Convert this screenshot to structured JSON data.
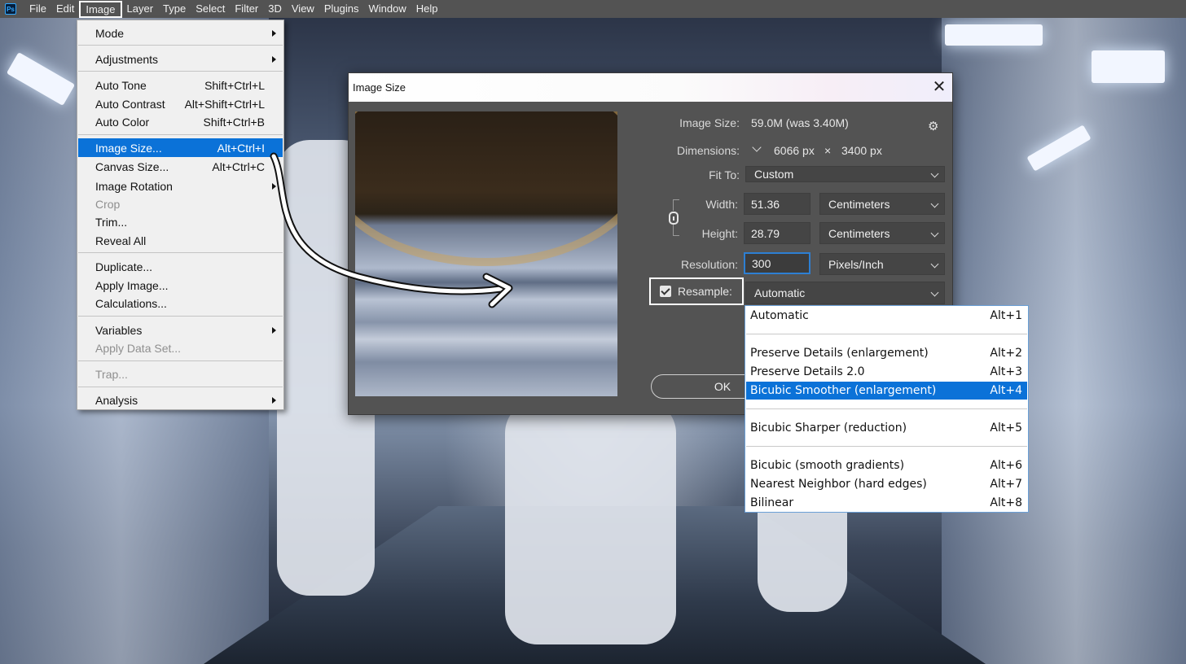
{
  "menubar": {
    "app_logo": "Ps",
    "items": [
      "File",
      "Edit",
      "Image",
      "Layer",
      "Type",
      "Select",
      "Filter",
      "3D",
      "View",
      "Plugins",
      "Window",
      "Help"
    ],
    "active": "Image"
  },
  "image_menu": {
    "mode": "Mode",
    "adjustments": "Adjustments",
    "auto_tone": {
      "label": "Auto Tone",
      "shortcut": "Shift+Ctrl+L"
    },
    "auto_contrast": {
      "label": "Auto Contrast",
      "shortcut": "Alt+Shift+Ctrl+L"
    },
    "auto_color": {
      "label": "Auto Color",
      "shortcut": "Shift+Ctrl+B"
    },
    "image_size": {
      "label": "Image Size...",
      "shortcut": "Alt+Ctrl+I"
    },
    "canvas_size": {
      "label": "Canvas Size...",
      "shortcut": "Alt+Ctrl+C"
    },
    "image_rotation": "Image Rotation",
    "crop": "Crop",
    "trim": "Trim...",
    "reveal_all": "Reveal All",
    "duplicate": "Duplicate...",
    "apply_image": "Apply Image...",
    "calculations": "Calculations...",
    "variables": "Variables",
    "apply_data_set": "Apply Data Set...",
    "trap": "Trap...",
    "analysis": "Analysis"
  },
  "dialog": {
    "title": "Image Size",
    "close": "✕",
    "image_size_label": "Image Size:",
    "image_size_value": "59.0M (was 3.40M)",
    "dimensions_label": "Dimensions:",
    "dimensions_width": "6066 px",
    "dimensions_x": "×",
    "dimensions_height": "3400 px",
    "fit_to_label": "Fit To:",
    "fit_to_value": "Custom",
    "width_label": "Width:",
    "width_value": "51.36",
    "width_unit": "Centimeters",
    "height_label": "Height:",
    "height_value": "28.79",
    "height_unit": "Centimeters",
    "resolution_label": "Resolution:",
    "resolution_value": "300",
    "resolution_unit": "Pixels/Inch",
    "resample_label": "Resample:",
    "resample_value": "Automatic",
    "ok": "OK"
  },
  "resample_options": [
    {
      "label": "Automatic",
      "shortcut": "Alt+1"
    },
    {
      "label": "Preserve Details (enlargement)",
      "shortcut": "Alt+2"
    },
    {
      "label": "Preserve Details 2.0",
      "shortcut": "Alt+3"
    },
    {
      "label": "Bicubic Smoother (enlargement)",
      "shortcut": "Alt+4"
    },
    {
      "label": "Bicubic Sharper (reduction)",
      "shortcut": "Alt+5"
    },
    {
      "label": "Bicubic (smooth gradients)",
      "shortcut": "Alt+6"
    },
    {
      "label": "Nearest Neighbor (hard edges)",
      "shortcut": "Alt+7"
    },
    {
      "label": "Bilinear",
      "shortcut": "Alt+8"
    }
  ],
  "colors": {
    "menu_highlight": "#0b72d8",
    "dialog_bg": "#535353",
    "menubar_bg": "#535353"
  }
}
